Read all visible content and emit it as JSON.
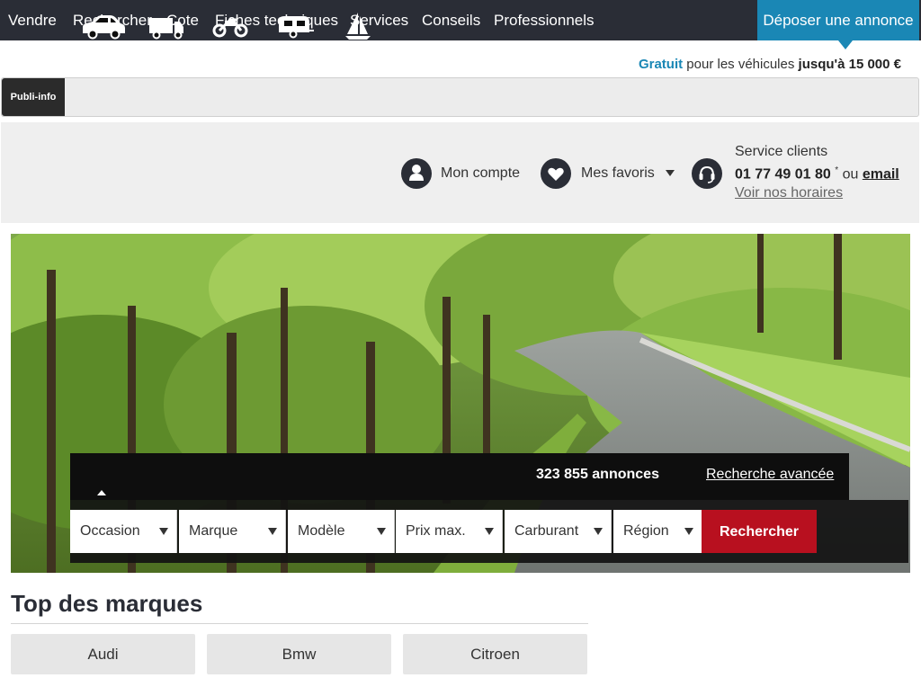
{
  "nav": {
    "items": [
      "Vendre",
      "Rechercher",
      "Cote",
      "Fiches techniques",
      "Services",
      "Conseils",
      "Professionnels"
    ],
    "deposit_label": "Déposer une annonce"
  },
  "promo": {
    "free": "Gratuit",
    "middle": " pour les véhicules ",
    "limit": "jusqu'à 15 000 €"
  },
  "publi": {
    "tag": "Publi-info"
  },
  "account": {
    "my_account": "Mon compte",
    "favorites": "Mes favoris",
    "service_title": "Service clients",
    "phone": "01 77 49 01 80",
    "asterisk": "*",
    "or": " ou ",
    "email": "email",
    "hours": "Voir nos horaires"
  },
  "search": {
    "vehicles": [
      "car-icon",
      "truck-icon",
      "motorcycle-icon",
      "caravan-icon",
      "sailboat-icon"
    ],
    "count": "323 855 annonces",
    "advanced": "Recherche avancée",
    "filters": [
      "Occasion",
      "Marque",
      "Modèle",
      "Prix max.",
      "Carburant",
      "Région"
    ],
    "submit": "Rechercher"
  },
  "brands": {
    "title": "Top des marques",
    "items": [
      "Audi",
      "Bmw",
      "Citroen"
    ]
  },
  "colors": {
    "nav_bg": "#2a2d36",
    "accent_blue": "#1a87b5",
    "search_red": "#b8101f"
  }
}
